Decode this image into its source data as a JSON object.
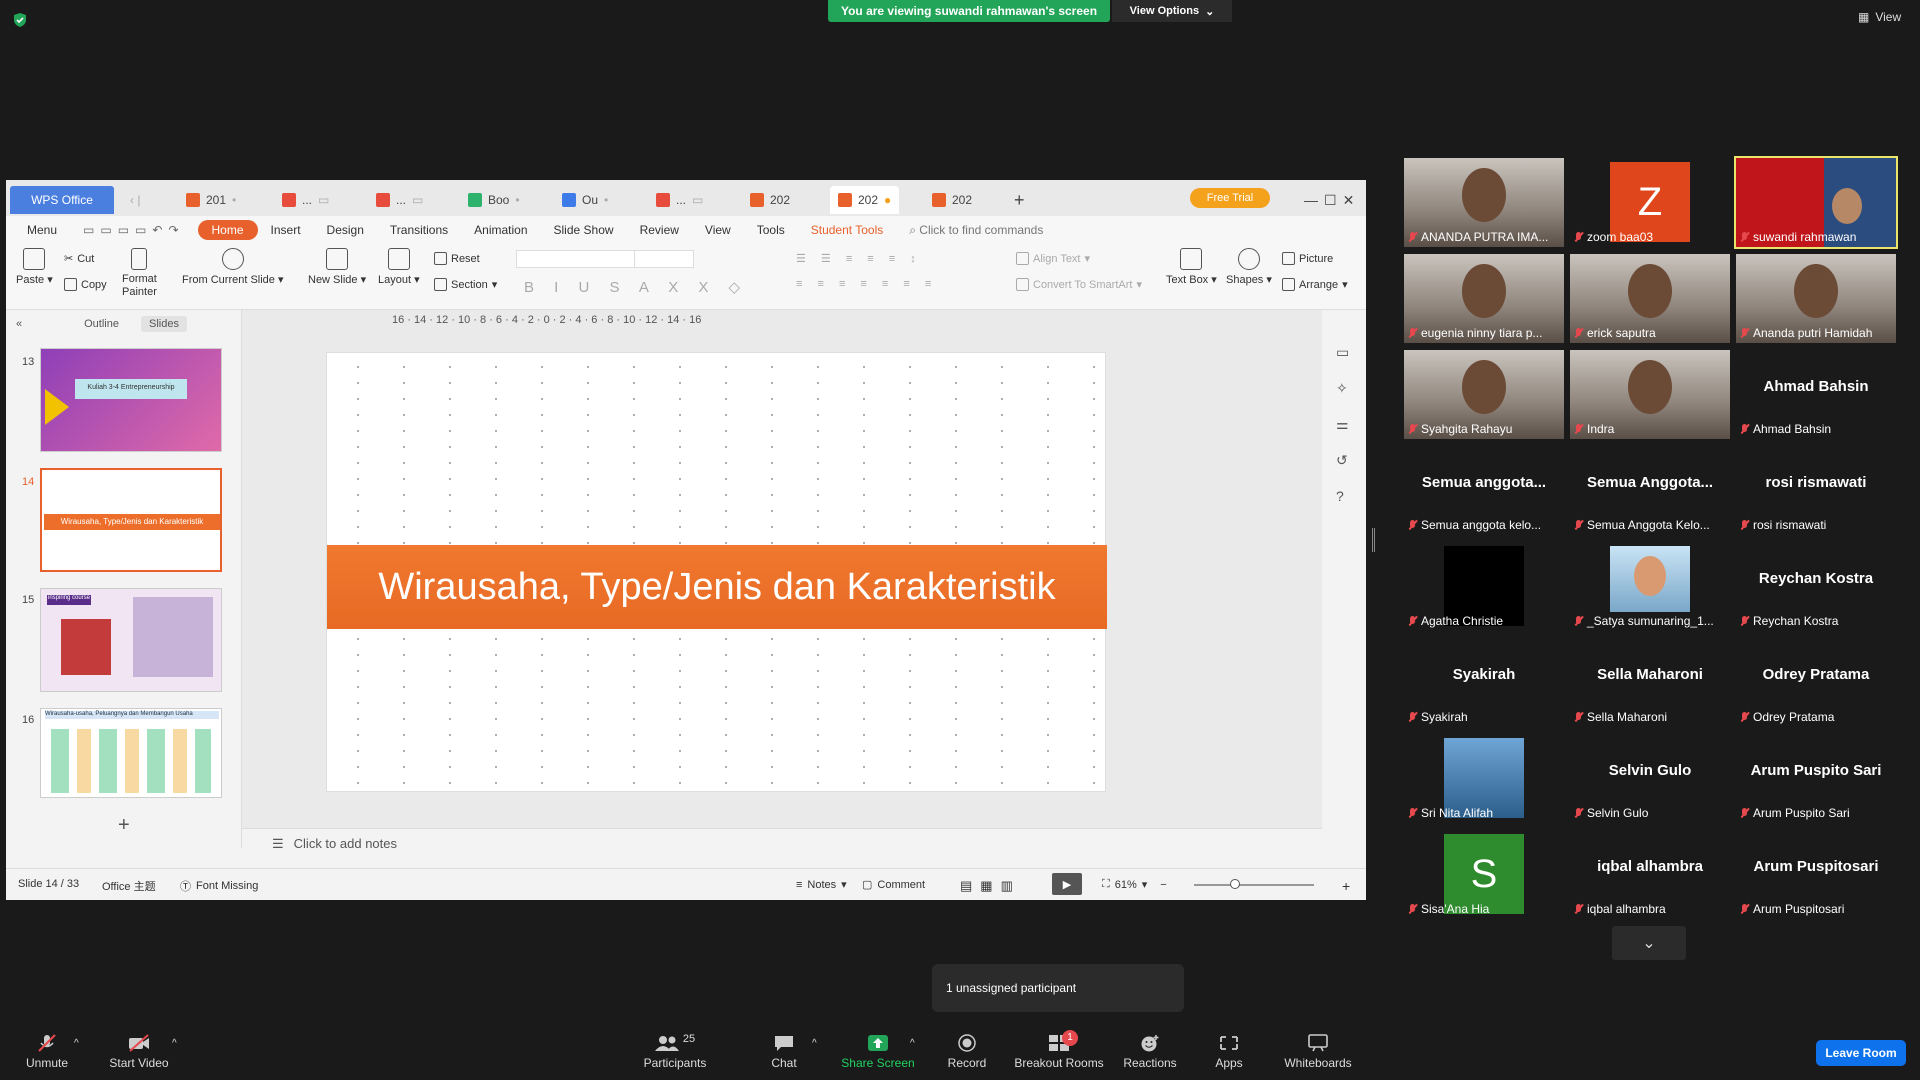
{
  "zoom_meeting": {
    "banner_text": "You are viewing suwandi rahmawan's screen",
    "view_options_label": "View Options",
    "view_label": "View",
    "unassigned_text": "1 unassigned participant",
    "leave_room_label": "Leave Room",
    "toolbar": {
      "unmute": "Unmute",
      "start_video": "Start Video",
      "participants": "Participants",
      "participants_count": "25",
      "chat": "Chat",
      "share_screen": "Share Screen",
      "record": "Record",
      "breakout_rooms": "Breakout Rooms",
      "breakout_badge": "1",
      "reactions": "Reactions",
      "apps": "Apps",
      "whiteboards": "Whiteboards"
    },
    "participants": [
      {
        "name": "ANANDA PUTRA IMA...",
        "big": "",
        "kind": "photo"
      },
      {
        "name": "zoom baa03",
        "big": "Z",
        "kind": "avatar-red"
      },
      {
        "name": "suwandi rahmawan",
        "big": "",
        "kind": "speaker"
      },
      {
        "name": "eugenia ninny tiara p...",
        "big": "",
        "kind": "photo"
      },
      {
        "name": "erick saputra",
        "big": "",
        "kind": "photo"
      },
      {
        "name": "Ananda putri Hamidah",
        "big": "",
        "kind": "photo"
      },
      {
        "name": "Syahgita Rahayu",
        "big": "",
        "kind": "photo"
      },
      {
        "name": "Indra",
        "big": "",
        "kind": "photo"
      },
      {
        "name": "Ahmad Bahsin",
        "big": "Ahmad Bahsin",
        "kind": "text"
      },
      {
        "name": "Semua anggota kelo...",
        "big": "Semua  anggota...",
        "kind": "text"
      },
      {
        "name": "Semua Anggota Kelo...",
        "big": "Semua  Anggota...",
        "kind": "text"
      },
      {
        "name": "rosi rismawati",
        "big": "rosi rismawati",
        "kind": "text"
      },
      {
        "name": "Agatha Christie",
        "big": "",
        "kind": "black"
      },
      {
        "name": "_Satya sumunaring_1...",
        "big": "",
        "kind": "avatar-img"
      },
      {
        "name": "Reychan Kostra",
        "big": "Reychan Kostra",
        "kind": "text"
      },
      {
        "name": "Syakirah",
        "big": "Syakirah",
        "kind": "text"
      },
      {
        "name": "Sella Maharoni",
        "big": "Sella Maharoni",
        "kind": "text"
      },
      {
        "name": "Odrey Pratama",
        "big": "Odrey Pratama",
        "kind": "text"
      },
      {
        "name": "Sri Nita Alifah",
        "big": "",
        "kind": "avatar-sky"
      },
      {
        "name": "Selvin Gulo",
        "big": "Selvin Gulo",
        "kind": "text"
      },
      {
        "name": "Arum Puspito Sari",
        "big": "Arum Puspito Sari",
        "kind": "text"
      },
      {
        "name": "Sisa'Ana Hia",
        "big": "S",
        "kind": "avatar-green"
      },
      {
        "name": "iqbal alhambra",
        "big": "iqbal alhambra",
        "kind": "text"
      },
      {
        "name": "Arum Puspitosari",
        "big": "Arum Puspitosari",
        "kind": "text"
      }
    ]
  },
  "wps": {
    "logo": "WPS Office",
    "tabs": [
      "201",
      "...",
      "...",
      "Boo",
      "Ou",
      "...",
      "202",
      "202",
      "202"
    ],
    "free_trial": "Free Trial",
    "menu": [
      "Menu",
      "Home",
      "Insert",
      "Design",
      "Transitions",
      "Animation",
      "Slide Show",
      "Review",
      "View",
      "Tools",
      "Student Tools"
    ],
    "search_placeholder": "Click to find commands",
    "ribbon": {
      "paste": "Paste",
      "cut": "Cut",
      "copy": "Copy",
      "format_painter_1": "Format",
      "format_painter_2": "Painter",
      "from_current_slide": "From Current Slide",
      "new_slide": "New Slide",
      "layout": "Layout",
      "reset": "Reset",
      "section": "Section",
      "align_text": "Align Text",
      "convert_smartart": "Convert To SmartArt",
      "text_box": "Text Box",
      "shapes": "Shapes",
      "picture": "Picture",
      "arrange": "Arrange"
    },
    "panel_tabs": [
      "Outline",
      "Slides"
    ],
    "slides": [
      {
        "num": "13",
        "title": "Kuliah 3-4 Entrepreneurship"
      },
      {
        "num": "14",
        "title": "Wirausaha, Type/Jenis dan Karakteristik"
      },
      {
        "num": "15",
        "title": "inspiring course"
      },
      {
        "num": "16",
        "title": "Wirausaha-usaha, Peluangnya dan Membangun Usaha"
      }
    ],
    "ruler": "16 · 14 · 12 · 10 · 8 · 6 · 4 · 2 · 0 · 2 · 4 · 6 · 8 · 10 · 12 · 14 · 16",
    "slide_title": "Wirausaha, Type/Jenis dan Karakteristik",
    "notes_placeholder": "Click to add notes",
    "status": {
      "slide_count": "Slide 14 / 33",
      "theme": "Office 主题",
      "font_missing": "Font Missing",
      "notes": "Notes",
      "comment": "Comment",
      "zoom": "61%"
    }
  }
}
